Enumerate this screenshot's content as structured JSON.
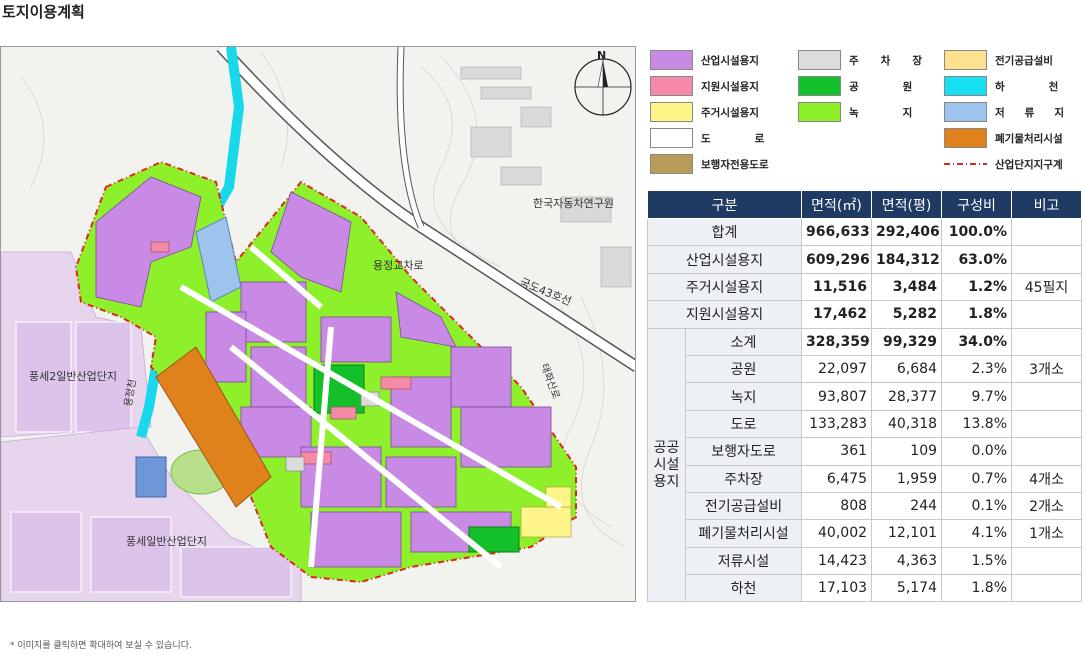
{
  "page": {
    "title": "토지이용계획",
    "footnote": "* 이미지를 클릭하면 확대하여 보실 수 있습니다."
  },
  "map": {
    "labels": {
      "north": "N",
      "kari": "한국자동차연구원",
      "interchange": "용정교차로",
      "route43": "국도43호선",
      "pungse2": "풍세2일반산업단지",
      "pungse": "풍세일반산업단지",
      "stream": "용정천",
      "mountain": "태화산로"
    }
  },
  "legend": [
    {
      "label": "산업시설용지",
      "color": "#c98ae6"
    },
    {
      "label": "지원시설용지",
      "color": "#f48aa6"
    },
    {
      "label": "주거시설용지",
      "color": "#fdf58a"
    },
    {
      "label": "도로",
      "color": "#ffffff"
    },
    {
      "label": "보행자전용도로",
      "color": "#b79c5a"
    },
    {
      "label": "주차장",
      "color": "#dcdcdc"
    },
    {
      "label": "공원",
      "color": "#13c02a"
    },
    {
      "label": "녹지",
      "color": "#8ef02a"
    },
    {
      "label": "전기공급설비",
      "color": "#fde090"
    },
    {
      "label": "하천",
      "color": "#18e0f0"
    },
    {
      "label": "저류지",
      "color": "#9ec4ee"
    },
    {
      "label": "폐기물처리시설",
      "color": "#e0821c"
    },
    {
      "label": "산업단지지구계",
      "color": "#e0261c"
    }
  ],
  "table": {
    "headers": [
      "구분",
      "면적(㎡)",
      "면적(평)",
      "구성비",
      "비고"
    ],
    "rows": [
      {
        "label": "합계",
        "m2": "966,633",
        "pyeong": "292,406",
        "ratio": "100.0%",
        "note": ""
      },
      {
        "label": "산업시설용지",
        "m2": "609,296",
        "pyeong": "184,312",
        "ratio": "63.0%",
        "note": ""
      },
      {
        "label": "주거시설용지",
        "m2": "11,516",
        "pyeong": "3,484",
        "ratio": "1.2%",
        "note": "45필지"
      },
      {
        "label": "지원시설용지",
        "m2": "17,462",
        "pyeong": "5,282",
        "ratio": "1.8%",
        "note": ""
      }
    ],
    "group_label": [
      "공공",
      "시설",
      "용지"
    ],
    "group_rows": [
      {
        "label": "소계",
        "m2": "328,359",
        "pyeong": "99,329",
        "ratio": "34.0%",
        "note": ""
      },
      {
        "label": "공원",
        "m2": "22,097",
        "pyeong": "6,684",
        "ratio": "2.3%",
        "note": "3개소"
      },
      {
        "label": "녹지",
        "m2": "93,807",
        "pyeong": "28,377",
        "ratio": "9.7%",
        "note": ""
      },
      {
        "label": "도로",
        "m2": "133,283",
        "pyeong": "40,318",
        "ratio": "13.8%",
        "note": ""
      },
      {
        "label": "보행자도로",
        "m2": "361",
        "pyeong": "109",
        "ratio": "0.0%",
        "note": ""
      },
      {
        "label": "주차장",
        "m2": "6,475",
        "pyeong": "1,959",
        "ratio": "0.7%",
        "note": "4개소"
      },
      {
        "label": "전기공급설비",
        "m2": "808",
        "pyeong": "244",
        "ratio": "0.1%",
        "note": "2개소"
      },
      {
        "label": "폐기물처리시설",
        "m2": "40,002",
        "pyeong": "12,101",
        "ratio": "4.1%",
        "note": "1개소"
      },
      {
        "label": "저류시설",
        "m2": "14,423",
        "pyeong": "4,363",
        "ratio": "1.5%",
        "note": ""
      },
      {
        "label": "하천",
        "m2": "17,103",
        "pyeong": "5,174",
        "ratio": "1.8%",
        "note": ""
      }
    ]
  }
}
